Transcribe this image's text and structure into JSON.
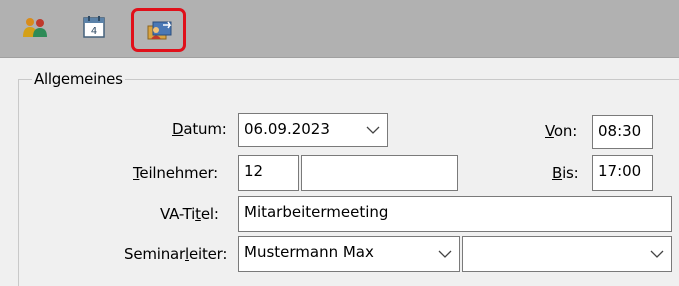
{
  "toolbar": {
    "buttons": [
      {
        "icon": "people-icon"
      },
      {
        "icon": "calendar-icon"
      },
      {
        "icon": "seminar-transfer-icon",
        "highlighted": true
      }
    ],
    "highlight_color": "#e0101a"
  },
  "group": {
    "title": "Allgemeines"
  },
  "form": {
    "datum": {
      "label_pre": "",
      "label_u": "D",
      "label_post": "atum:",
      "value": "06.09.2023"
    },
    "von": {
      "label_pre": "",
      "label_u": "V",
      "label_post": "on:",
      "value": "08:30"
    },
    "teilnehmer": {
      "label_pre": "",
      "label_u": "T",
      "label_post": "eilnehmer:",
      "value": "12",
      "value2": ""
    },
    "bis": {
      "label_pre": "",
      "label_u": "B",
      "label_post": "is:",
      "value": "17:00"
    },
    "va_titel": {
      "label_pre": "VA-Ti",
      "label_u": "t",
      "label_post": "el:",
      "value": "Mitarbeitermeeting"
    },
    "seminarleiter": {
      "label_pre": "Seminar",
      "label_u": "l",
      "label_post": "eiter:",
      "value": "Mustermann Max",
      "value2": ""
    }
  }
}
